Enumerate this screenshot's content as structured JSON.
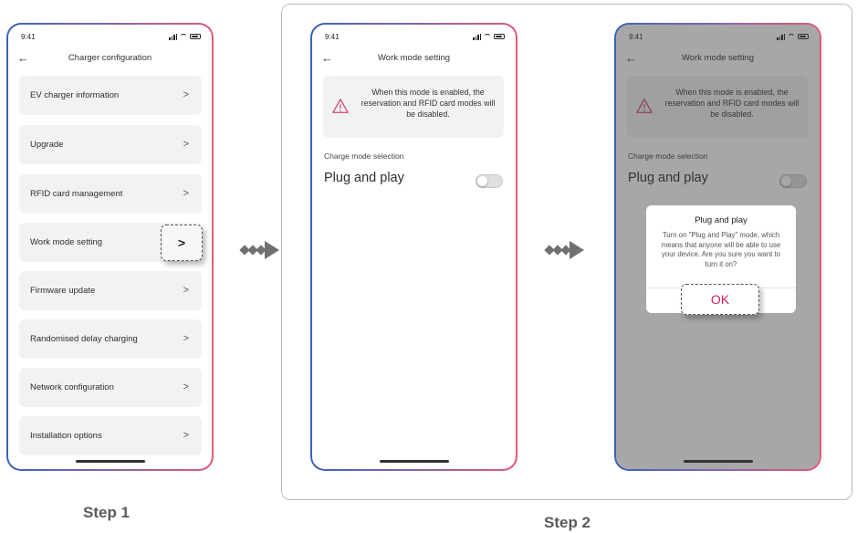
{
  "status_bar": {
    "time": "9:41"
  },
  "step1": {
    "caption": "Step 1",
    "title": "Charger configuration",
    "back_icon": "arrow-left-icon",
    "items": [
      {
        "label": "EV charger information"
      },
      {
        "label": "Upgrade"
      },
      {
        "label": "RFID card management"
      },
      {
        "label": "Work mode setting",
        "highlighted": true
      },
      {
        "label": "Firmware update"
      },
      {
        "label": "Randomised delay charging"
      },
      {
        "label": "Network configuration"
      },
      {
        "label": "Installation options"
      }
    ],
    "chevron": ">"
  },
  "step2": {
    "caption": "Step 2",
    "title": "Work mode setting",
    "warning": "When this mode is enabled, the reservation and RFID card modes will be disabled.",
    "warning_icon": "warning-triangle-icon",
    "section_label": "Charge mode selection",
    "plug_label": "Plug and play",
    "toggle_on": false,
    "dialog": {
      "title": "Plug and play",
      "message": "Turn on \"Plug and Play\" mode, which means that anyone will be able to use your device. Are you sure you want to turn it on?",
      "ok_label": "OK"
    }
  },
  "colors": {
    "accent": "#c8235a",
    "warning_icon": "#d64569",
    "frame_gradient_start": "#3d63b5",
    "frame_gradient_end": "#e05a78",
    "arrow": "#707070"
  }
}
